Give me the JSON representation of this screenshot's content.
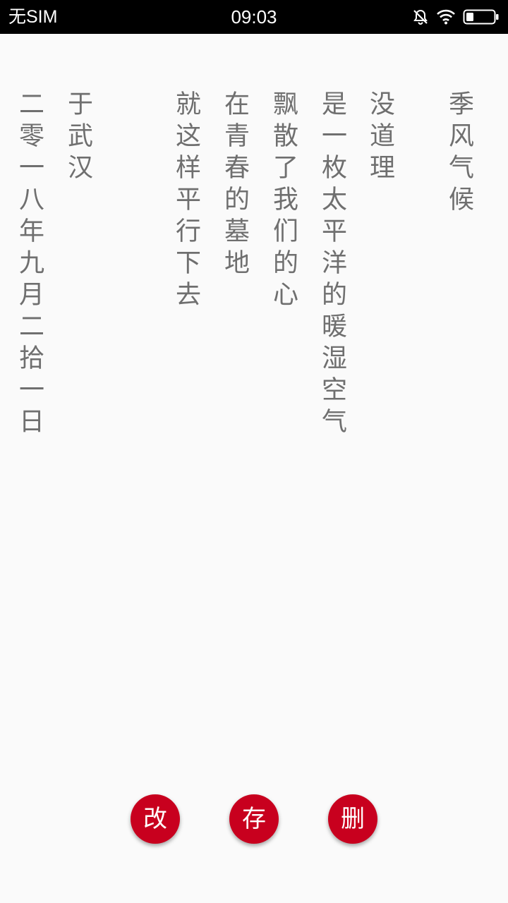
{
  "status_bar": {
    "carrier": "无SIM",
    "time": "09:03",
    "icons": [
      "mute-bell-icon",
      "wifi-icon",
      "battery-icon"
    ]
  },
  "poem": {
    "columns": [
      "季风气候",
      "没道理",
      "是一枚太平洋的暖湿空气",
      "飘散了我们的心",
      "在青春的墓地",
      "就这样平行下去",
      "于武汉",
      "二零一八年九月二拾一日"
    ]
  },
  "actions": {
    "edit_label": "改",
    "save_label": "存",
    "delete_label": "删"
  },
  "colors": {
    "accent": "#c8001e",
    "text": "#6f6f6f",
    "background": "#fafafa",
    "status_bar": "#000000"
  }
}
